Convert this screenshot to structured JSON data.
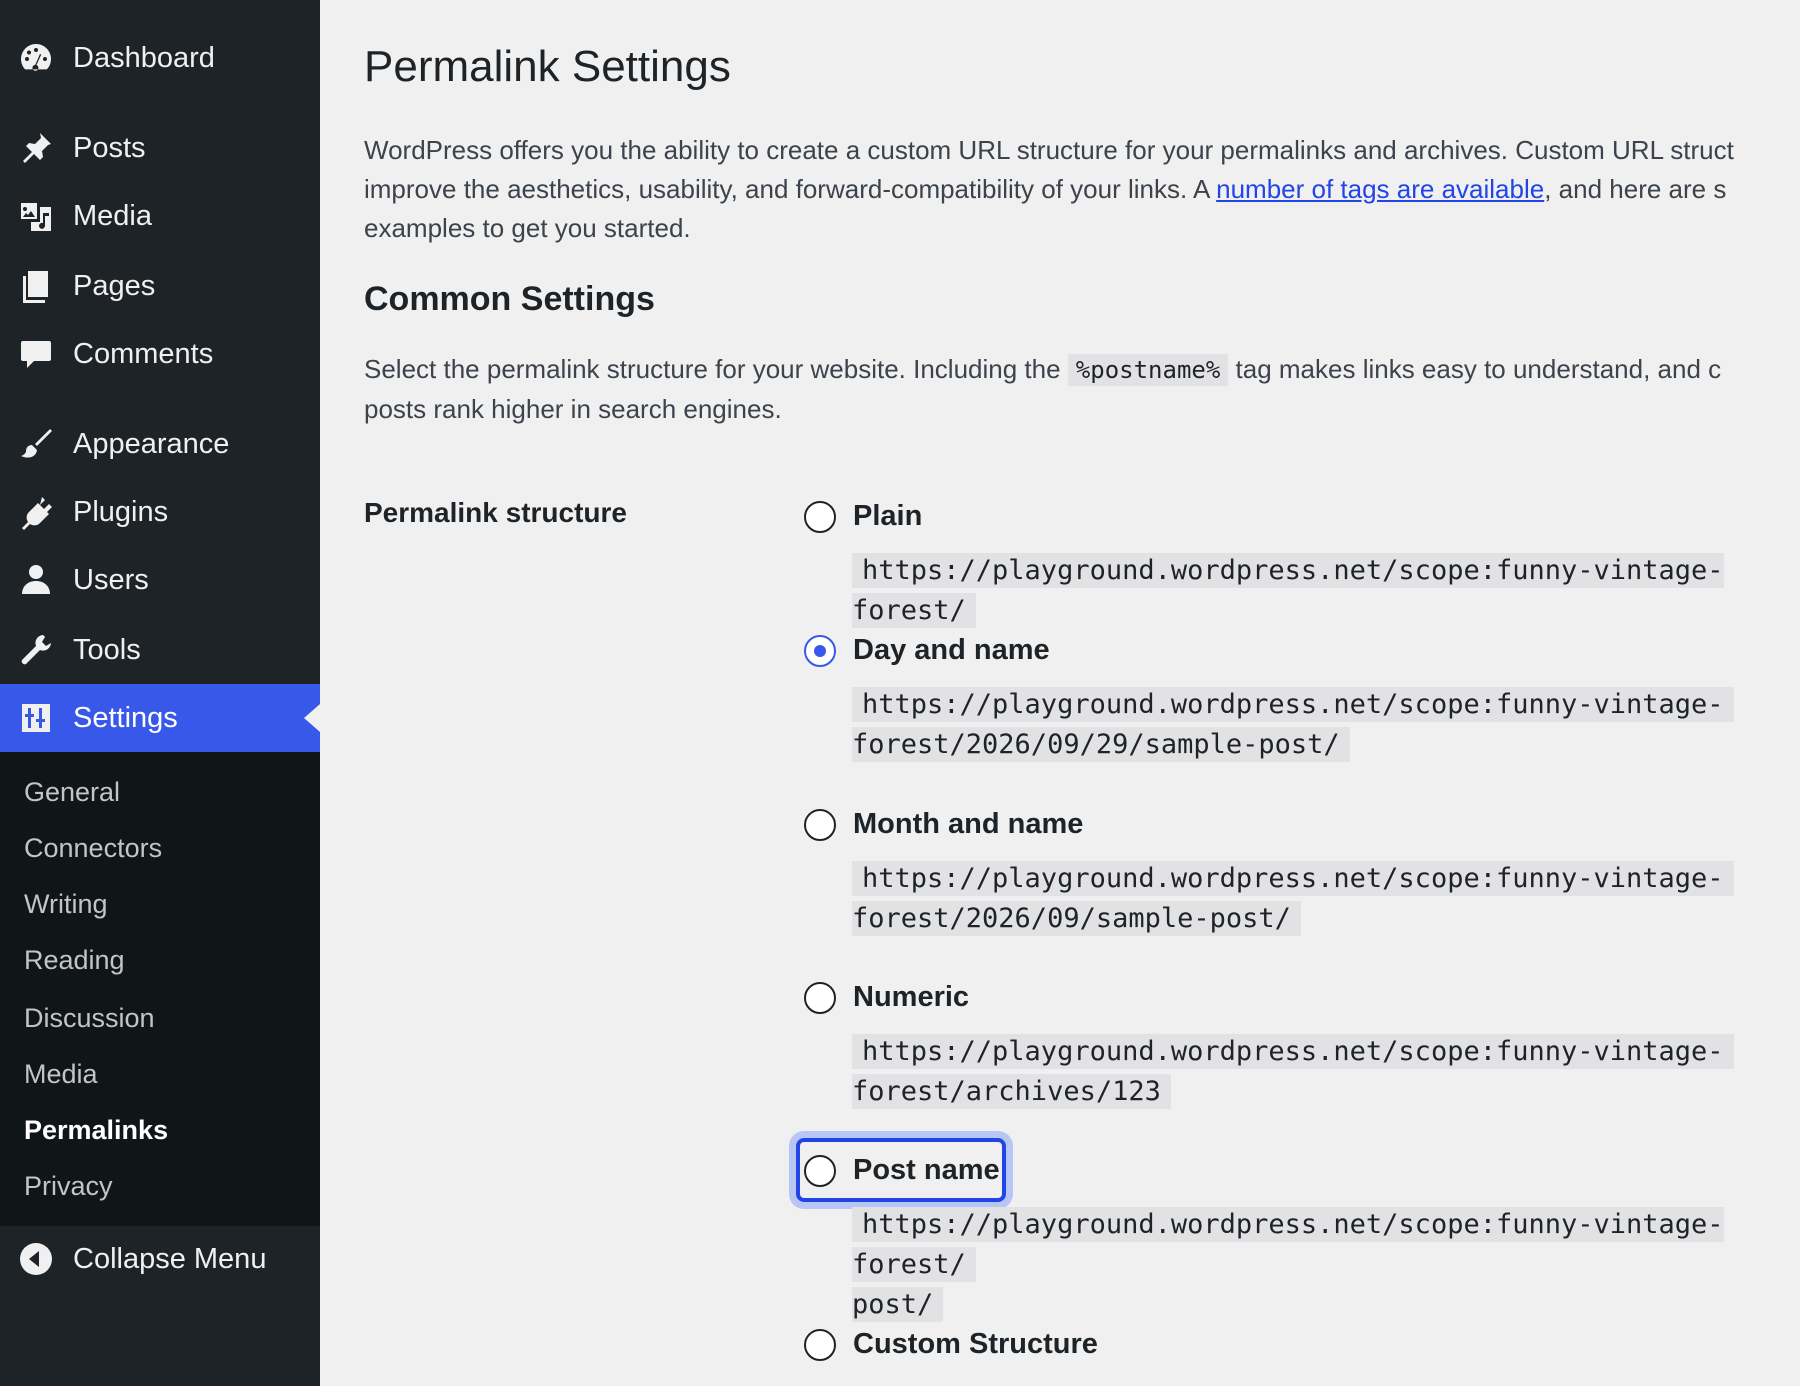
{
  "sidebar": {
    "items": [
      {
        "label": "Dashboard",
        "icon": "dashboard-icon"
      },
      {
        "label": "Posts",
        "icon": "pin-icon"
      },
      {
        "label": "Media",
        "icon": "media-icon"
      },
      {
        "label": "Pages",
        "icon": "pages-icon"
      },
      {
        "label": "Comments",
        "icon": "comment-icon"
      },
      {
        "label": "Appearance",
        "icon": "paintbrush-icon"
      },
      {
        "label": "Plugins",
        "icon": "plugin-icon"
      },
      {
        "label": "Users",
        "icon": "user-icon"
      },
      {
        "label": "Tools",
        "icon": "wrench-icon"
      },
      {
        "label": "Settings",
        "icon": "settings-icon",
        "active": true
      }
    ],
    "submenu": [
      {
        "label": "General"
      },
      {
        "label": "Connectors"
      },
      {
        "label": "Writing"
      },
      {
        "label": "Reading"
      },
      {
        "label": "Discussion"
      },
      {
        "label": "Media"
      },
      {
        "label": "Permalinks",
        "current": true
      },
      {
        "label": "Privacy"
      }
    ],
    "collapse": {
      "label": "Collapse Menu",
      "icon": "collapse-arrow-icon"
    },
    "accent_color": "#3858e9"
  },
  "main": {
    "title": "Permalink Settings",
    "intro": {
      "line1": "WordPress offers you the ability to create a custom URL structure for your permalinks and archives. Custom URL struct",
      "line2_before": "improve the aesthetics, usability, and forward-compatibility of your links. A ",
      "line2_link": "number of tags are available",
      "line2_after": ", and here are s",
      "line3": "examples to get you started."
    },
    "section_heading": "Common Settings",
    "select_text": {
      "before": "Select the permalink structure for your website. Including the ",
      "code": "%postname%",
      "after": " tag makes links easy to understand, and c",
      "line2": "posts rank higher in search engines."
    },
    "field_label": "Permalink structure",
    "options": [
      {
        "label": "Plain",
        "checked": false,
        "url_lines": [
          "https://playground.wordpress.net/scope:funny-vintage-forest/"
        ]
      },
      {
        "label": "Day and name",
        "checked": true,
        "url_lines": [
          "https://playground.wordpress.net/scope:funny-vintage-",
          "forest/2026/09/29/sample-post/"
        ]
      },
      {
        "label": "Month and name",
        "checked": false,
        "url_lines": [
          "https://playground.wordpress.net/scope:funny-vintage-",
          "forest/2026/09/sample-post/"
        ]
      },
      {
        "label": "Numeric",
        "checked": false,
        "url_lines": [
          "https://playground.wordpress.net/scope:funny-vintage-",
          "forest/archives/123"
        ]
      },
      {
        "label": "Post name",
        "checked": false,
        "focused": true,
        "url_lines": [
          "https://playground.wordpress.net/scope:funny-vintage-forest/",
          "post/"
        ]
      },
      {
        "label": "Custom Structure",
        "checked": false
      }
    ]
  }
}
